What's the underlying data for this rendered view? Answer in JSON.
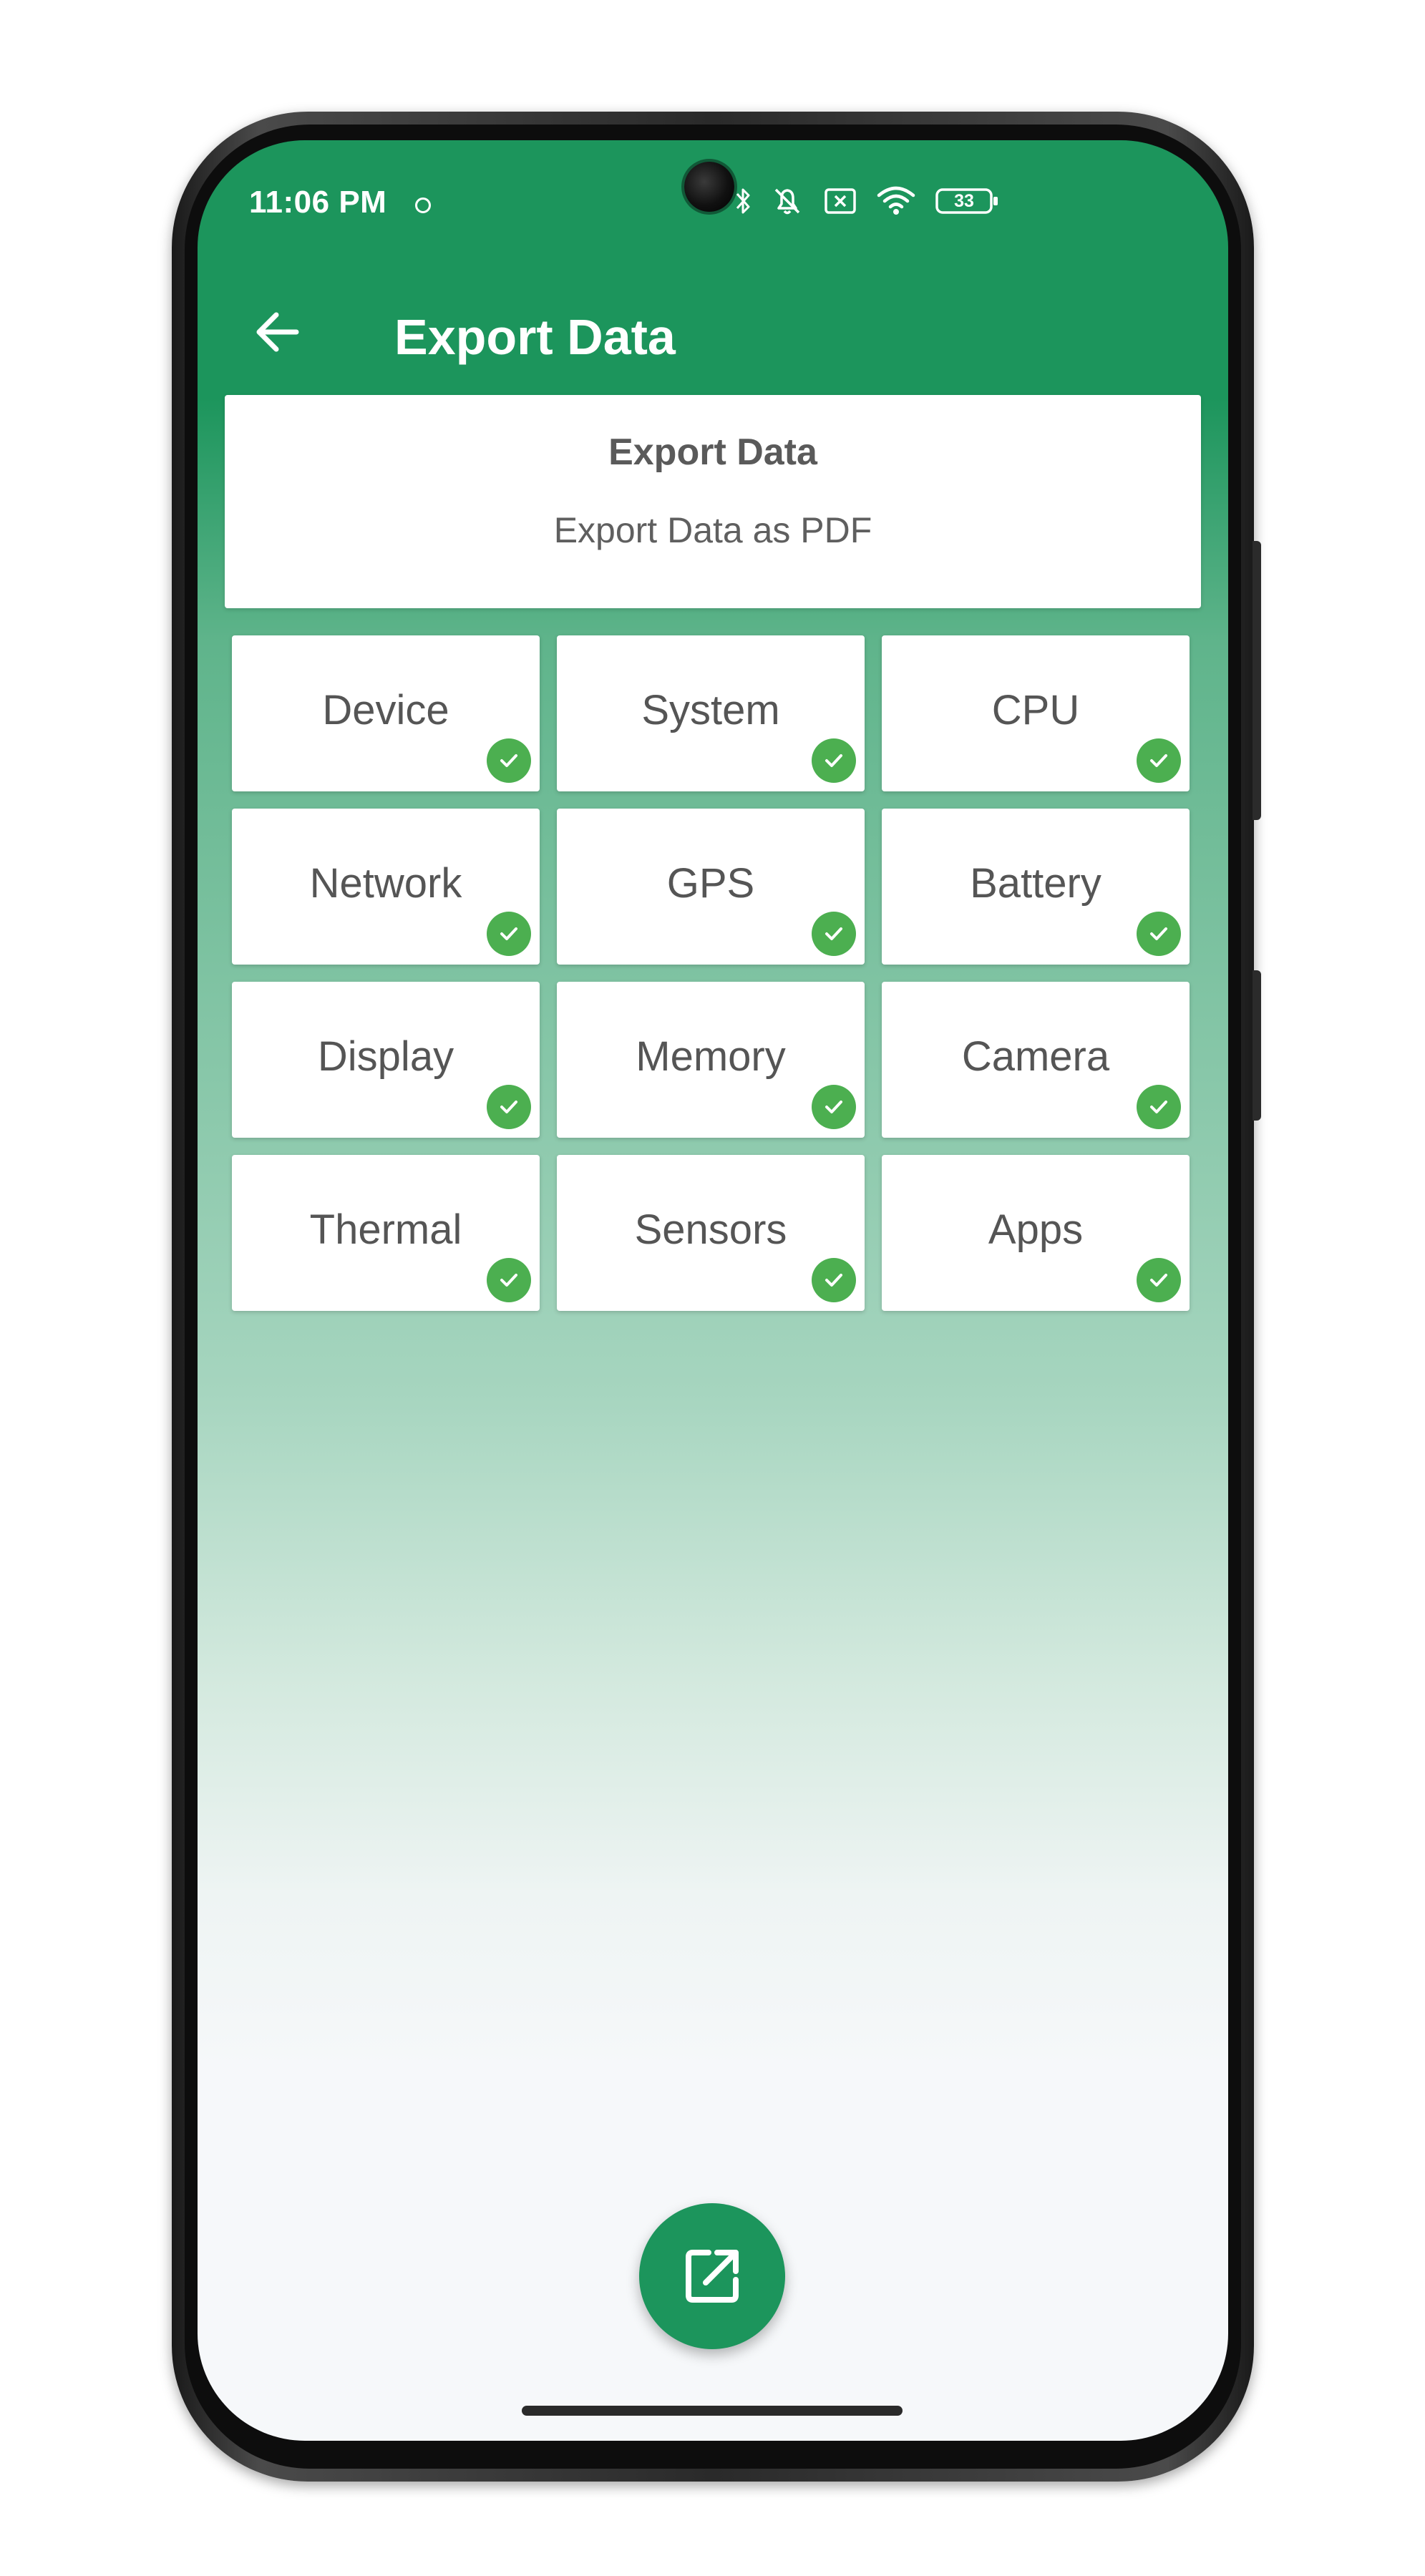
{
  "status_bar": {
    "time": "11:06 PM",
    "battery": "33",
    "icons": [
      "bluetooth-icon",
      "mute-bell-icon",
      "no-sim-icon",
      "wifi-icon",
      "battery-icon"
    ]
  },
  "app_bar": {
    "title": "Export Data",
    "back_icon": "arrow-left-icon"
  },
  "header_card": {
    "title": "Export Data",
    "subtitle": "Export Data as PDF"
  },
  "categories": [
    {
      "label": "Device",
      "checked": true
    },
    {
      "label": "System",
      "checked": true
    },
    {
      "label": "CPU",
      "checked": true
    },
    {
      "label": "Network",
      "checked": true
    },
    {
      "label": "GPS",
      "checked": true
    },
    {
      "label": "Battery",
      "checked": true
    },
    {
      "label": "Display",
      "checked": true
    },
    {
      "label": "Memory",
      "checked": true
    },
    {
      "label": "Camera",
      "checked": true
    },
    {
      "label": "Thermal",
      "checked": true
    },
    {
      "label": "Sensors",
      "checked": true
    },
    {
      "label": "Apps",
      "checked": true
    }
  ],
  "fab": {
    "icon": "open-in-new-icon"
  },
  "colors": {
    "primary": "#1c955c",
    "check": "#4caf50",
    "text": "#555555",
    "card": "#ffffff",
    "background": "#f6f8fa"
  }
}
